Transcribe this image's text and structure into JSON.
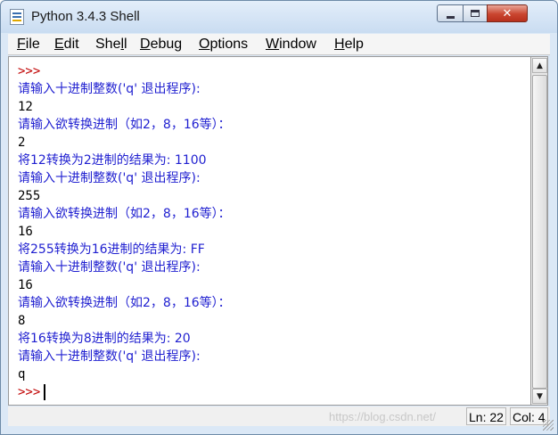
{
  "window": {
    "title": "Python 3.4.3 Shell"
  },
  "menu": [
    {
      "mnemonic": "F",
      "rest": "ile"
    },
    {
      "mnemonic": "E",
      "rest": "dit"
    },
    {
      "pre": "She",
      "mnemonic": "l",
      "rest": "l"
    },
    {
      "mnemonic": "D",
      "rest": "ebug"
    },
    {
      "mnemonic": "O",
      "rest": "ptions"
    },
    {
      "mnemonic": "W",
      "rest": "indow"
    },
    {
      "mnemonic": "H",
      "rest": "elp"
    }
  ],
  "shell": {
    "lines": [
      {
        "kind": "prompt",
        "text": ">>>"
      },
      {
        "kind": "out",
        "text": "请输入十进制整数('q' 退出程序):"
      },
      {
        "kind": "in",
        "text": "12"
      },
      {
        "kind": "out",
        "text": "请输入欲转换进制（如2，8，16等）："
      },
      {
        "kind": "in",
        "text": "2"
      },
      {
        "kind": "out",
        "text": "将12转换为2进制的结果为: 1100"
      },
      {
        "kind": "out",
        "text": "请输入十进制整数('q' 退出程序):"
      },
      {
        "kind": "in",
        "text": "255"
      },
      {
        "kind": "out",
        "text": "请输入欲转换进制（如2，8，16等）："
      },
      {
        "kind": "in",
        "text": "16"
      },
      {
        "kind": "out",
        "text": "将255转换为16进制的结果为: FF"
      },
      {
        "kind": "out",
        "text": "请输入十进制整数('q' 退出程序):"
      },
      {
        "kind": "in",
        "text": "16"
      },
      {
        "kind": "out",
        "text": "请输入欲转换进制（如2，8，16等）："
      },
      {
        "kind": "in",
        "text": "8"
      },
      {
        "kind": "out",
        "text": "将16转换为8进制的结果为: 20"
      },
      {
        "kind": "out",
        "text": "请输入十进制整数('q' 退出程序):"
      },
      {
        "kind": "in",
        "text": "q"
      },
      {
        "kind": "prompt",
        "text": ">>>",
        "caret": true
      }
    ]
  },
  "status": {
    "line": "Ln: 22",
    "col": "Col: 4"
  },
  "watermark": "https://blog.csdn.net/",
  "colors": {
    "prompt": "#c00000",
    "output": "#1f1fd0",
    "input": "#000000",
    "close_button": "#c9452f"
  },
  "icons": {
    "app": "python-idle-icon",
    "minimize": "minimize-icon",
    "maximize": "maximize-icon",
    "close": "close-icon",
    "scroll_up": "arrow-up-icon",
    "scroll_down": "arrow-down-icon"
  }
}
